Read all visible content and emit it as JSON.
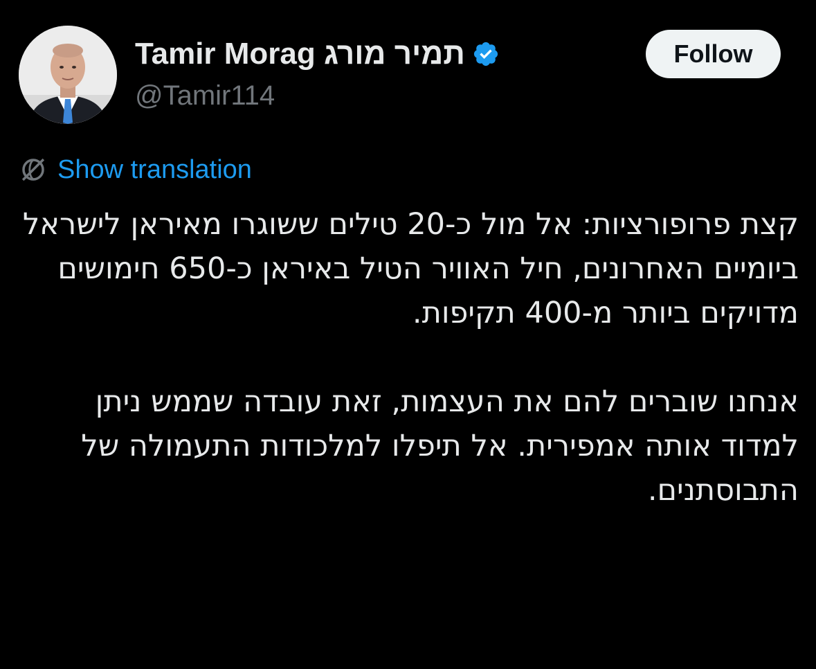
{
  "author": {
    "display_name": "Tamir Morag תמיר מורג",
    "handle": "@Tamir114",
    "verified": true,
    "avatar_icon": "profile-photo"
  },
  "actions": {
    "follow_label": "Follow"
  },
  "translation": {
    "icon": "globe-icon",
    "label": "Show translation"
  },
  "tweet": {
    "paragraphs": [
      "קצת פרופורציות: אל מול כ-20 טילים ששוגרו מאיראן לישראל ביומיים האחרונים, חיל האוויר הטיל באיראן כ-650 חימושים מדויקים ביותר מ-400 תקיפות.",
      "אנחנו שוברים להם את העצמות, זאת עובדה שממש ניתן למדוד אותה אמפירית. אל תיפלו למלכודות התעמולה של התבוסתנים."
    ]
  },
  "colors": {
    "background": "#000000",
    "text": "#e7e9ea",
    "secondary_text": "#71767b",
    "link": "#1d9bf0",
    "verified_badge": "#1d9bf0",
    "follow_button_bg": "#eff3f4"
  }
}
